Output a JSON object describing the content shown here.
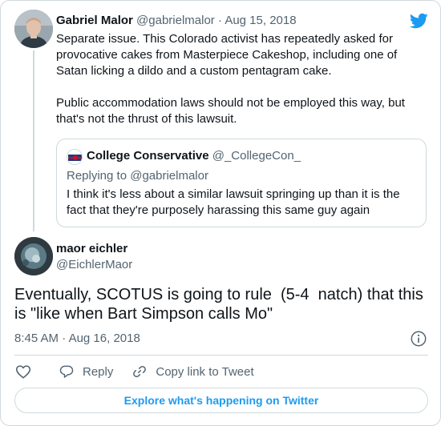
{
  "quoted_parent": {
    "author_name": "Gabriel Malor",
    "author_handle": "@gabrielmalor",
    "date": "Aug 15, 2018",
    "paragraphs": [
      "Separate issue. This Colorado activist has repeatedly asked for provocative cakes from Masterpiece Cakeshop, including one of Satan licking a dildo and a custom pentagram cake.",
      "Public accommodation laws should not be employed this way, but that's not the thrust of this lawsuit."
    ],
    "quote": {
      "author_name": "College Conservative",
      "author_handle": "@_CollegeCon_",
      "replying_to": "Replying to @gabrielmalor",
      "text": "I think it's less about a similar lawsuit springing up than it is the fact that they're purposely harassing this same guy again"
    }
  },
  "tweet": {
    "author_name": "maor eichler",
    "author_handle": "@EichlerMaor",
    "text": "Eventually, SCOTUS is going to rule  (5-4  natch) that this is \"like when Bart Simpson calls Mo\"",
    "time": "8:45 AM",
    "date": "Aug 16, 2018"
  },
  "actions": {
    "reply_label": "Reply",
    "copy_link_label": "Copy link to Tweet",
    "explore_label": "Explore what's happening on Twitter"
  },
  "icons": {
    "brand": "twitter-bird-icon",
    "info": "info-icon",
    "like": "heart-icon",
    "reply": "reply-bubble-icon",
    "copy_link": "link-icon"
  },
  "colors": {
    "brand_blue": "#1d9bf0",
    "text": "#0f1419",
    "muted": "#536471",
    "border": "#cfd9de"
  }
}
